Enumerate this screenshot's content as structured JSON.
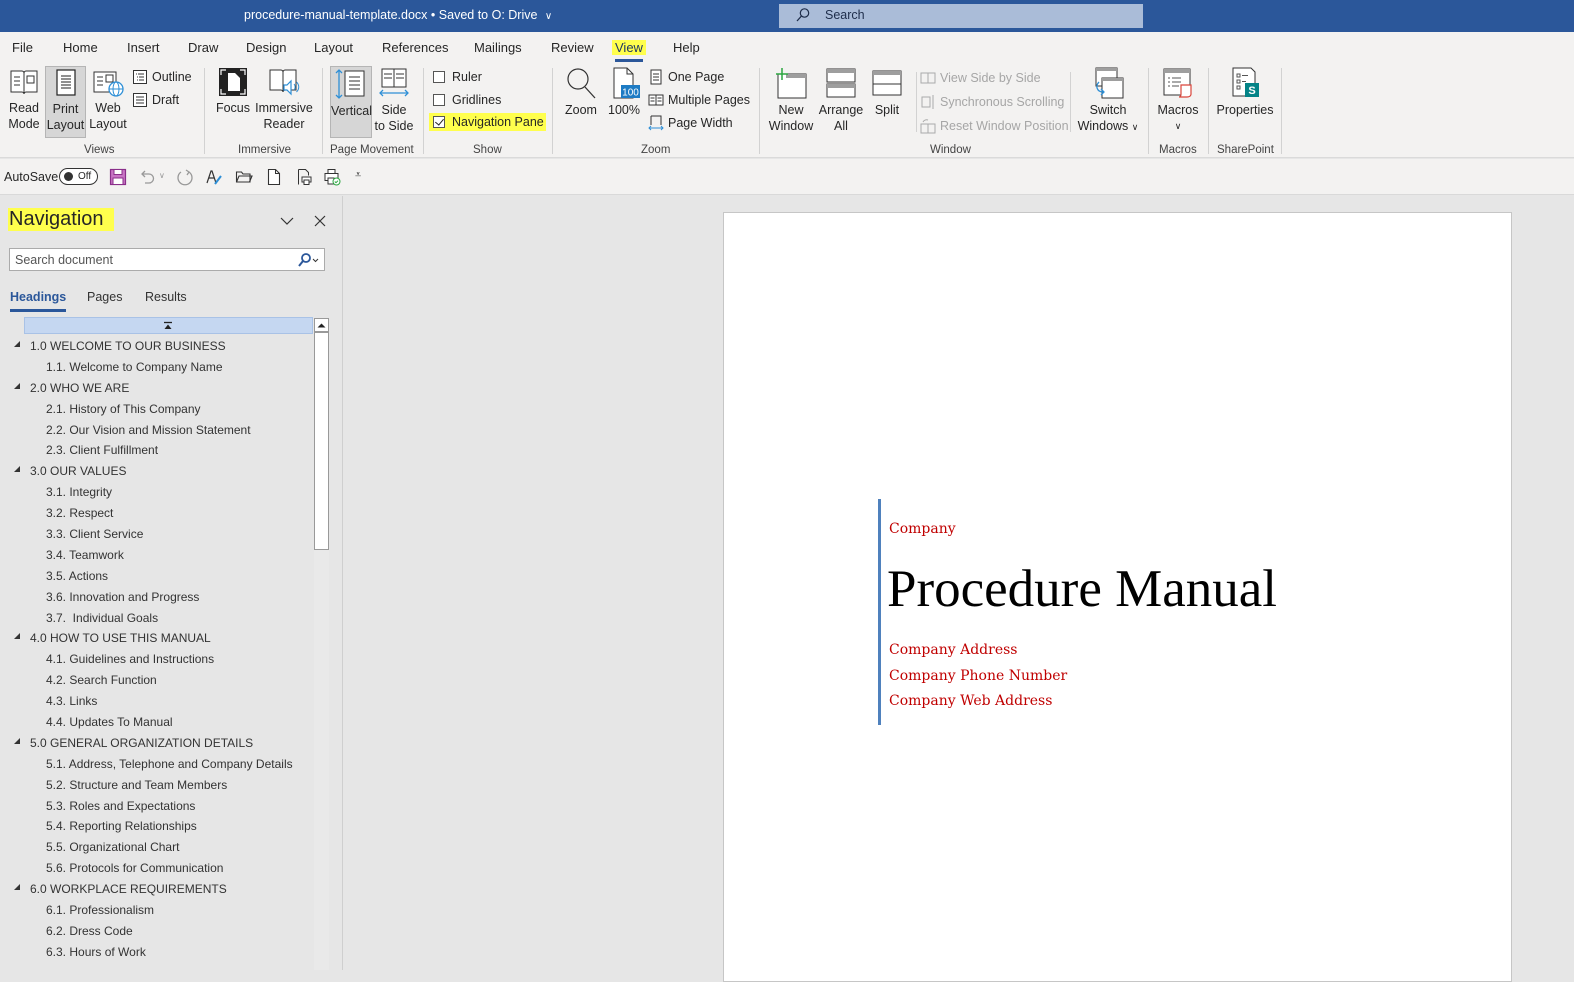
{
  "titlebar": {
    "document_name": "procedure-manual-template.docx",
    "save_status": "Saved to O: Drive",
    "search_label": "Search"
  },
  "menu": {
    "tabs": [
      "File",
      "Home",
      "Insert",
      "Draw",
      "Design",
      "Layout",
      "References",
      "Mailings",
      "Review",
      "View",
      "Help"
    ],
    "active_tab": "View"
  },
  "ribbon": {
    "groups": {
      "views": "Views",
      "immersive": "Immersive",
      "page_movement": "Page Movement",
      "show": "Show",
      "zoom": "Zoom",
      "window": "Window",
      "macros": "Macros",
      "sharepoint": "SharePoint"
    },
    "views": {
      "read_mode_1": "Read",
      "read_mode_2": "Mode",
      "print_layout_1": "Print",
      "print_layout_2": "Layout",
      "web_layout_1": "Web",
      "web_layout_2": "Layout",
      "outline": "Outline",
      "draft": "Draft"
    },
    "immersive": {
      "focus": "Focus",
      "immersive_reader_1": "Immersive",
      "immersive_reader_2": "Reader"
    },
    "page_movement": {
      "vertical": "Vertical",
      "side_to_side_1": "Side",
      "side_to_side_2": "to Side"
    },
    "show": {
      "ruler": "Ruler",
      "ruler_checked": false,
      "gridlines": "Gridlines",
      "gridlines_checked": false,
      "navigation_pane": "Navigation Pane",
      "navigation_pane_checked": true
    },
    "zoom": {
      "zoom": "Zoom",
      "hundred": "100%",
      "hundred_badge": "100",
      "one_page": "One Page",
      "multiple_pages": "Multiple Pages",
      "page_width": "Page Width"
    },
    "window": {
      "new_window_1": "New",
      "new_window_2": "Window",
      "arrange_all_1": "Arrange",
      "arrange_all_2": "All",
      "split": "Split",
      "view_side_by_side": "View Side by Side",
      "synchronous_scrolling": "Synchronous Scrolling",
      "reset_window_position": "Reset Window Position",
      "switch_windows_1": "Switch",
      "switch_windows_2": "Windows"
    },
    "macros": {
      "macros": "Macros"
    },
    "sharepoint": {
      "properties": "Properties",
      "badge": "S"
    }
  },
  "qat": {
    "autosave_label": "AutoSave",
    "autosave_state": "Off"
  },
  "navigation": {
    "title": "Navigation",
    "search_placeholder": "Search document",
    "tabs": [
      "Headings",
      "Pages",
      "Results"
    ],
    "active_tab": "Headings",
    "headings": [
      {
        "level": 1,
        "text": "1.0 WELCOME TO OUR BUSINESS"
      },
      {
        "level": 2,
        "text": "1.1. Welcome to Company Name"
      },
      {
        "level": 1,
        "text": "2.0 WHO WE ARE"
      },
      {
        "level": 2,
        "text": "2.1. History of This Company"
      },
      {
        "level": 2,
        "text": "2.2. Our Vision and Mission Statement"
      },
      {
        "level": 2,
        "text": "2.3. Client Fulfillment"
      },
      {
        "level": 1,
        "text": "3.0 OUR VALUES"
      },
      {
        "level": 2,
        "text": "3.1. Integrity"
      },
      {
        "level": 2,
        "text": "3.2. Respect"
      },
      {
        "level": 2,
        "text": "3.3. Client Service"
      },
      {
        "level": 2,
        "text": "3.4. Teamwork"
      },
      {
        "level": 2,
        "text": "3.5. Actions"
      },
      {
        "level": 2,
        "text": "3.6. Innovation and Progress"
      },
      {
        "level": 2,
        "text": "3.7.  Individual Goals"
      },
      {
        "level": 1,
        "text": "4.0 HOW TO USE THIS MANUAL"
      },
      {
        "level": 2,
        "text": "4.1. Guidelines and Instructions"
      },
      {
        "level": 2,
        "text": "4.2. Search Function"
      },
      {
        "level": 2,
        "text": "4.3. Links"
      },
      {
        "level": 2,
        "text": "4.4. Updates To Manual"
      },
      {
        "level": 1,
        "text": "5.0 GENERAL ORGANIZATION DETAILS"
      },
      {
        "level": 2,
        "text": "5.1. Address, Telephone and Company Details"
      },
      {
        "level": 2,
        "text": "5.2. Structure and Team Members"
      },
      {
        "level": 2,
        "text": "5.3. Roles and Expectations"
      },
      {
        "level": 2,
        "text": "5.4. Reporting Relationships"
      },
      {
        "level": 2,
        "text": "5.5. Organizational Chart"
      },
      {
        "level": 2,
        "text": "5.6. Protocols for Communication"
      },
      {
        "level": 1,
        "text": "6.0 WORKPLACE REQUIREMENTS"
      },
      {
        "level": 2,
        "text": "6.1. Professionalism"
      },
      {
        "level": 2,
        "text": "6.2. Dress Code"
      },
      {
        "level": 2,
        "text": "6.3. Hours of Work"
      }
    ]
  },
  "document": {
    "company": "Company",
    "title": "Procedure Manual",
    "address": "Company Address",
    "phone": "Company Phone Number",
    "web": "Company Web Address"
  },
  "colors": {
    "title_bar": "#2b579a",
    "highlight": "#ffff4d",
    "accent_red": "#c00000",
    "cover_rule": "#4f81bd"
  }
}
